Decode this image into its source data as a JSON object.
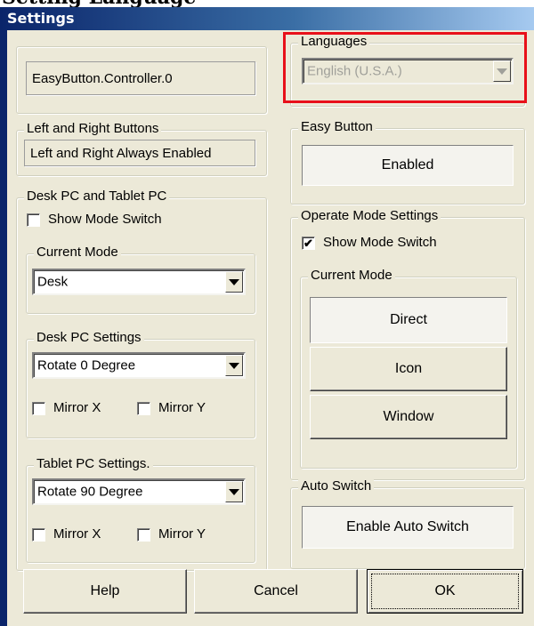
{
  "page_heading": "Setting Language",
  "window": {
    "title": "Settings"
  },
  "controller_name": "EasyButton.Controller.0",
  "languages": {
    "legend": "Languages",
    "selected": "English (U.S.A.)",
    "disabled": true,
    "highlight_color": "#e8101a"
  },
  "left_right": {
    "legend": "Left and Right Buttons",
    "value": "Left and Right Always Enabled"
  },
  "easy_button": {
    "legend": "Easy Button",
    "button_label": "Enabled"
  },
  "desk_tablet": {
    "legend": "Desk PC and Tablet PC",
    "show_mode_switch": {
      "label": "Show Mode Switch",
      "checked": false
    },
    "current_mode": {
      "legend": "Current Mode",
      "selected": "Desk"
    },
    "desk_settings": {
      "legend": "Desk PC Settings",
      "rotation": "Rotate 0 Degree",
      "mirror_x": {
        "label": "Mirror X",
        "checked": false
      },
      "mirror_y": {
        "label": "Mirror Y",
        "checked": false
      }
    },
    "tablet_settings": {
      "legend": "Tablet PC Settings.",
      "rotation": "Rotate 90 Degree",
      "mirror_x": {
        "label": "Mirror X",
        "checked": false
      },
      "mirror_y": {
        "label": "Mirror Y",
        "checked": false
      }
    }
  },
  "operate_mode": {
    "legend": "Operate Mode Settings",
    "show_mode_switch": {
      "label": "Show Mode Switch",
      "checked": true,
      "mark": "✔"
    },
    "current_mode": {
      "legend": "Current Mode",
      "options": [
        "Direct",
        "Icon",
        "Window"
      ],
      "selected": "Direct"
    }
  },
  "auto_switch": {
    "legend": "Auto Switch",
    "button_label": "Enable Auto Switch"
  },
  "footer": {
    "help": "Help",
    "cancel": "Cancel",
    "ok": "OK"
  },
  "icons": [
    "chevron-down-icon",
    "checkmark-icon"
  ]
}
